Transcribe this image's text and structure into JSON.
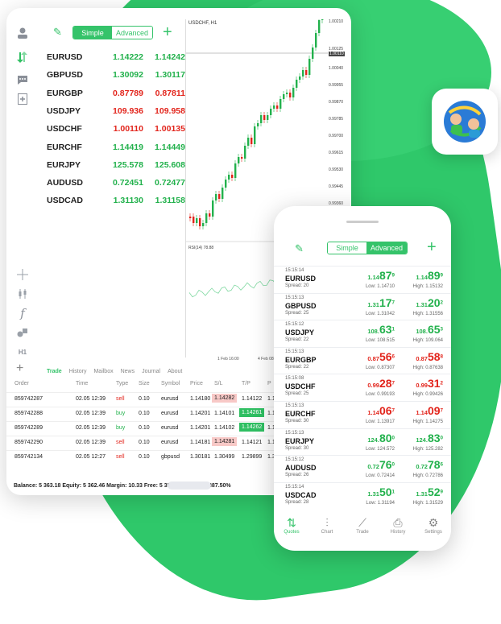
{
  "tablet": {
    "segment": {
      "simple": "Simple",
      "advanced": "Advanced"
    },
    "quotes": [
      {
        "symbol": "EURUSD",
        "bid": "1.14222",
        "ask": "1.14242",
        "color": "g"
      },
      {
        "symbol": "GBPUSD",
        "bid": "1.30092",
        "ask": "1.30117",
        "color": "g"
      },
      {
        "symbol": "EURGBP",
        "bid": "0.87789",
        "ask": "0.87811",
        "color": "r"
      },
      {
        "symbol": "USDJPY",
        "bid": "109.936",
        "ask": "109.958",
        "color": "r"
      },
      {
        "symbol": "USDCHF",
        "bid": "1.00110",
        "ask": "1.00135",
        "color": "r"
      },
      {
        "symbol": "EURCHF",
        "bid": "1.14419",
        "ask": "1.14449",
        "color": "g"
      },
      {
        "symbol": "EURJPY",
        "bid": "125.578",
        "ask": "125.608",
        "color": "g"
      },
      {
        "symbol": "AUDUSD",
        "bid": "0.72451",
        "ask": "0.72477",
        "color": "g"
      },
      {
        "symbol": "USDCAD",
        "bid": "1.31130",
        "ask": "1.31158",
        "color": "g"
      }
    ],
    "chart": {
      "title": "USDCHF, H1",
      "rsi": "RSI(14) 78.88",
      "price_labels": [
        "1.00210",
        "1.00125",
        "1.00110",
        "1.00040",
        "0.99955",
        "0.99870",
        "0.99785",
        "0.99700",
        "0.99615",
        "0.99530",
        "0.99445",
        "0.99360"
      ],
      "time_labels": [
        "1 Feb 16:00",
        "4 Feb 08:00"
      ],
      "timeframe": "H1"
    },
    "tabs": [
      "Trade",
      "History",
      "Mailbox",
      "News",
      "Journal",
      "About"
    ],
    "orders_header": [
      "Order",
      "Time",
      "Type",
      "Size",
      "Symbol",
      "Price",
      "S/L",
      "T/P",
      "P"
    ],
    "orders": [
      {
        "order": "859742287",
        "time": "02.05 12:39",
        "type": "sell",
        "size": "0.10",
        "symbol": "eurusd",
        "price": "1.14180",
        "sl": "1.14282",
        "tp": "1.14122",
        "p": "1.14",
        "hl": "sl"
      },
      {
        "order": "859742288",
        "time": "02.05 12:39",
        "type": "buy",
        "size": "0.10",
        "symbol": "eurusd",
        "price": "1.14201",
        "sl": "1.14101",
        "tp": "1.14261",
        "p": "1.14",
        "hl": "tp"
      },
      {
        "order": "859742289",
        "time": "02.05 12:39",
        "type": "buy",
        "size": "0.10",
        "symbol": "eurusd",
        "price": "1.14201",
        "sl": "1.14102",
        "tp": "1.14262",
        "p": "1.14",
        "hl": "tp"
      },
      {
        "order": "859742290",
        "time": "02.05 12:39",
        "type": "sell",
        "size": "0.10",
        "symbol": "eurusd",
        "price": "1.14181",
        "sl": "1.14281",
        "tp": "1.14121",
        "p": "1.14",
        "hl": "sl"
      },
      {
        "order": "859742134",
        "time": "02.05 12:27",
        "type": "sell",
        "size": "0.10",
        "symbol": "gbpusd",
        "price": "1.30181",
        "sl": "1.30499",
        "tp": "1.29899",
        "p": "1.30",
        "hl": ""
      }
    ],
    "balance": "Balance: 5 363.18 Equity: 5 362.46 Margin: 10.33 Free: 5 352.13 Level: 51 887.50%"
  },
  "phone": {
    "segment": {
      "simple": "Simple",
      "advanced": "Advanced"
    },
    "quotes": [
      {
        "time": "15:15:14",
        "symbol": "EURUSD",
        "spread": "Spread: 20",
        "bid_pre": "1.14",
        "bid_big": "87",
        "bid_sup": "9",
        "ask_pre": "1.14",
        "ask_big": "89",
        "ask_sup": "9",
        "low": "Low: 1.14710",
        "high": "High: 1.15132",
        "color": "g"
      },
      {
        "time": "15:15:13",
        "symbol": "GBPUSD",
        "spread": "Spread: 25",
        "bid_pre": "1.31",
        "bid_big": "17",
        "bid_sup": "7",
        "ask_pre": "1.31",
        "ask_big": "20",
        "ask_sup": "2",
        "low": "Low: 1.31042",
        "high": "High: 1.31556",
        "color": "g"
      },
      {
        "time": "15:15:12",
        "symbol": "USDJPY",
        "spread": "Spread: 22",
        "bid_pre": "108.",
        "bid_big": "63",
        "bid_sup": "1",
        "ask_pre": "108.",
        "ask_big": "65",
        "ask_sup": "3",
        "low": "Low: 108.515",
        "high": "High: 109.064",
        "color": "g"
      },
      {
        "time": "15:15:13",
        "symbol": "EURGBP",
        "spread": "Spread: 22",
        "bid_pre": "0.87",
        "bid_big": "56",
        "bid_sup": "6",
        "ask_pre": "0.87",
        "ask_big": "58",
        "ask_sup": "8",
        "low": "Low: 0.87307",
        "high": "High: 0.87638",
        "color": "r"
      },
      {
        "time": "15:15:08",
        "symbol": "USDCHF",
        "spread": "Spread: 25",
        "bid_pre": "0.99",
        "bid_big": "28",
        "bid_sup": "7",
        "ask_pre": "0.99",
        "ask_big": "31",
        "ask_sup": "2",
        "low": "Low: 0.99193",
        "high": "High: 0.99426",
        "color": "r"
      },
      {
        "time": "15:15:13",
        "symbol": "EURCHF",
        "spread": "Spread: 30",
        "bid_pre": "1.14",
        "bid_big": "06",
        "bid_sup": "7",
        "ask_pre": "1.14",
        "ask_big": "09",
        "ask_sup": "7",
        "low": "Low: 1.13917",
        "high": "High: 1.14275",
        "color": "r"
      },
      {
        "time": "15:15:13",
        "symbol": "EURJPY",
        "spread": "Spread: 30",
        "bid_pre": "124.",
        "bid_big": "80",
        "bid_sup": "0",
        "ask_pre": "124.",
        "ask_big": "83",
        "ask_sup": "0",
        "low": "Low: 124.572",
        "high": "High: 125.282",
        "color": "g"
      },
      {
        "time": "15:15:12",
        "symbol": "AUDUSD",
        "spread": "Spread: 26",
        "bid_pre": "0.72",
        "bid_big": "76",
        "bid_sup": "0",
        "ask_pre": "0.72",
        "ask_big": "78",
        "ask_sup": "6",
        "low": "Low: 0.72414",
        "high": "High: 0.72786",
        "color": "g"
      },
      {
        "time": "15:15:14",
        "symbol": "USDCAD",
        "spread": "Spread: 28",
        "bid_pre": "1.31",
        "bid_big": "50",
        "bid_sup": "1",
        "ask_pre": "1.31",
        "ask_big": "52",
        "ask_sup": "9",
        "low": "Low: 1.31194",
        "high": "High: 1.31529",
        "color": "g"
      }
    ],
    "nav": [
      {
        "label": "Quotes",
        "icon": "quotes-icon"
      },
      {
        "label": "Chart",
        "icon": "chart-icon"
      },
      {
        "label": "Trade",
        "icon": "trade-icon"
      },
      {
        "label": "History",
        "icon": "history-icon"
      },
      {
        "label": "Settings",
        "icon": "settings-icon"
      }
    ]
  },
  "colors": {
    "green": "#22b14c",
    "red": "#e2241b",
    "brand": "#35c36a"
  }
}
